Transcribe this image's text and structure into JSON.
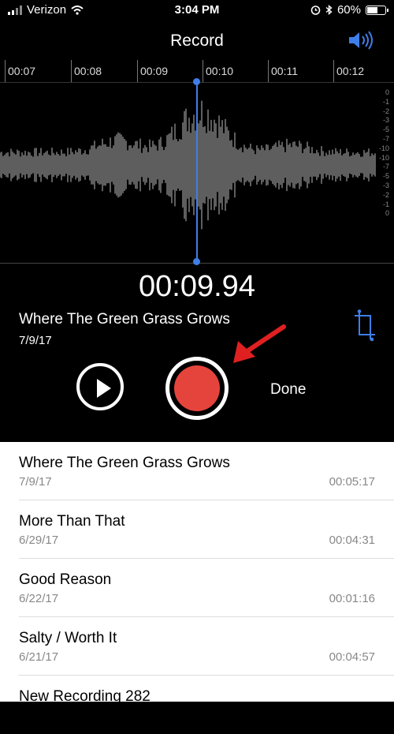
{
  "status_bar": {
    "carrier": "Verizon",
    "time": "3:04 PM",
    "battery": "60%",
    "battery_level": 0.6
  },
  "header": {
    "title": "Record"
  },
  "timeline": {
    "ticks": [
      "00:07",
      "00:08",
      "00:09",
      "00:10",
      "00:11",
      "00:12"
    ]
  },
  "db_scale": [
    "0",
    "-1",
    "-2",
    "-3",
    "-5",
    "-7",
    "-10",
    "-10",
    "-7",
    "-5",
    "-3",
    "-2",
    "-1",
    "0"
  ],
  "recorder": {
    "current_time": "00:09.94",
    "title": "Where The Green Grass Grows",
    "date": "7/9/17",
    "done_label": "Done"
  },
  "recordings": [
    {
      "name": "Where The Green Grass Grows",
      "date": "7/9/17",
      "duration": "00:05:17"
    },
    {
      "name": "More Than That",
      "date": "6/29/17",
      "duration": "00:04:31"
    },
    {
      "name": "Good Reason",
      "date": "6/22/17",
      "duration": "00:01:16"
    },
    {
      "name": "Salty / Worth It",
      "date": "6/21/17",
      "duration": "00:04:57"
    },
    {
      "name": "New Recording 282",
      "date": "",
      "duration": ""
    }
  ],
  "colors": {
    "accent": "#3f7ee8",
    "record": "#e5443c",
    "annotation_arrow": "#e02020"
  }
}
